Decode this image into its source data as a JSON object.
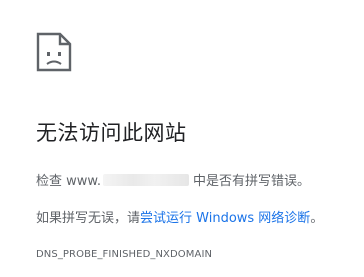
{
  "icon": "sad-page-icon",
  "colors": {
    "title": "#202124",
    "body_text": "#5f6368",
    "link": "#1a73e8"
  },
  "error": {
    "title": "无法访问此网站",
    "check_prefix": "检查 www.",
    "check_suffix": "中是否有拼写错误。",
    "suggest_prefix": "如果拼写无误，请",
    "suggest_link": "尝试运行 Windows 网络诊断",
    "suggest_suffix": "。",
    "code": "DNS_PROBE_FINISHED_NXDOMAIN"
  }
}
